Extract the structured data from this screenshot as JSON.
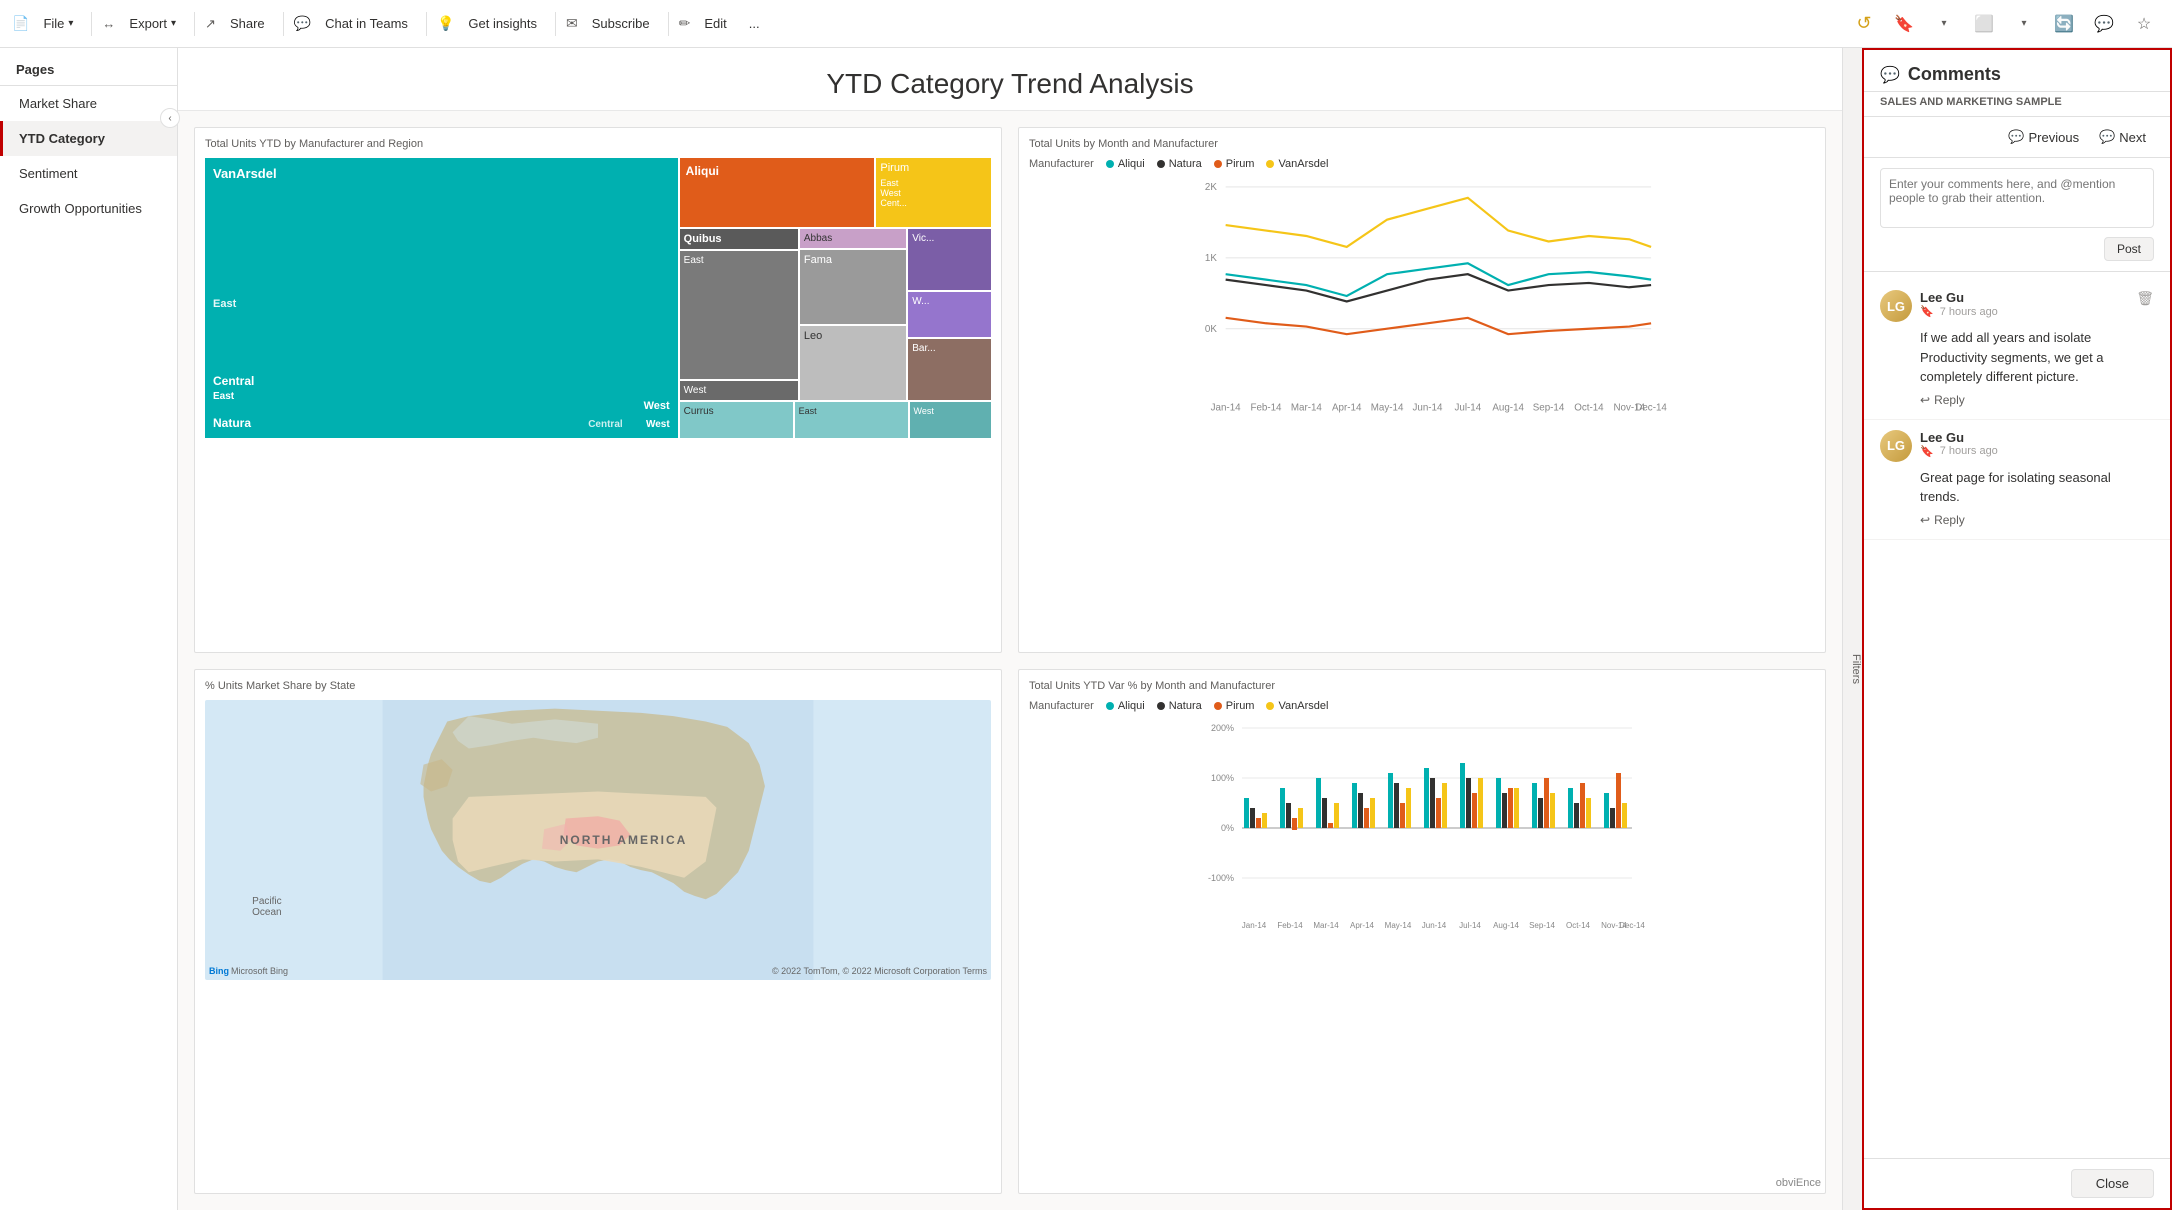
{
  "topbar": {
    "file_label": "File",
    "export_label": "Export",
    "share_label": "Share",
    "chat_label": "Chat in Teams",
    "insights_label": "Get insights",
    "subscribe_label": "Subscribe",
    "edit_label": "Edit",
    "more_label": "..."
  },
  "sidebar": {
    "header": "Pages",
    "items": [
      {
        "label": "Market Share",
        "active": false
      },
      {
        "label": "YTD Category",
        "active": true
      },
      {
        "label": "Sentiment",
        "active": false
      },
      {
        "label": "Growth Opportunities",
        "active": false
      }
    ]
  },
  "page": {
    "title": "YTD Category Trend Analysis"
  },
  "charts": {
    "treemap_title": "Total Units YTD by Manufacturer and Region",
    "line_title": "Total Units by Month and Manufacturer",
    "map_title": "% Units Market Share by State",
    "bar_title": "Total Units YTD Var % by Month and Manufacturer",
    "legend_items": [
      {
        "label": "Aliqui",
        "color": "#00b0b0"
      },
      {
        "label": "Natura",
        "color": "#323130"
      },
      {
        "label": "Pirum",
        "color": "#e05c1a"
      },
      {
        "label": "VanArsdel",
        "color": "#f5c518"
      }
    ],
    "line_y_labels": [
      "2K",
      "1K",
      "0K"
    ],
    "line_x_labels": [
      "Jan-14",
      "Feb-14",
      "Mar-14",
      "Apr-14",
      "May-14",
      "Jun-14",
      "Jul-14",
      "Aug-14",
      "Sep-14",
      "Oct-14",
      "Nov-14",
      "Dec-14"
    ],
    "map_title_text": "NORTH AMERICA",
    "map_pacific": "Pacific\nOcean",
    "map_bing": "Microsoft Bing",
    "map_copyright": "© 2022 TomTom, © 2022 Microsoft Corporation  Terms",
    "bar_y_labels": [
      "200%",
      "100%",
      "0%",
      "-100%"
    ],
    "bar_x_labels": [
      "Jan-14",
      "Feb-14",
      "Mar-14",
      "Apr-14",
      "May-14",
      "Jun-14",
      "Jul-14",
      "Aug-14",
      "Sep-14",
      "Oct-14",
      "Nov-14",
      "Dec-14"
    ]
  },
  "filters": {
    "label": "Filters"
  },
  "comments": {
    "title": "Comments",
    "subtitle": "SALES AND MARKETING SAMPLE",
    "nav_previous": "Previous",
    "nav_next": "Next",
    "input_placeholder": "Enter your comments here, and @mention people to grab their attention.",
    "post_label": "Post",
    "items": [
      {
        "author": "Lee Gu",
        "time": "7 hours ago",
        "body": "If we add all years and isolate Productivity segments, we get a completely different picture.",
        "reply_label": "Reply"
      },
      {
        "author": "Lee Gu",
        "time": "7 hours ago",
        "body": "Great page for isolating seasonal trends.",
        "reply_label": "Reply"
      }
    ],
    "close_label": "Close"
  },
  "branding": {
    "label": "obviEnce"
  }
}
